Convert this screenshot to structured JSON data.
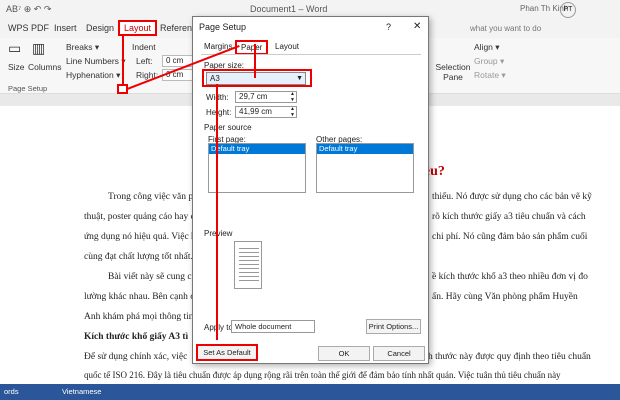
{
  "titlebar": {
    "quick": "AB⁷ ⊕ ↶ ↷",
    "title": "Document1 – Word",
    "user": "Phan Th Kinh",
    "initials": "PT"
  },
  "tabs": [
    "WPS PDF",
    "Insert",
    "Design",
    "Layout",
    "Reference"
  ],
  "tell_me": "what you want to do",
  "ribbon": {
    "size": "Size",
    "columns": "Columns",
    "breaks": "Breaks ▾",
    "line_numbers": "Line Numbers ▾",
    "hyphenation": "Hyphenation ▾",
    "indent": "Indent",
    "left": "Left:",
    "right": "Right:",
    "left_val": "0 cm",
    "right_val": "0 cm",
    "selection_pane": "Selection Pane",
    "align": "Align ▾",
    "group": "Group ▾",
    "rotate": "Rotate ▾",
    "page_setup": "Page Setup"
  },
  "doc": {
    "heading": "iêu?",
    "lines": [
      "Trong công việc văn phòng",
      "thiếu. Nó được sử dụng cho các bản vẽ kỹ",
      "thuật, poster quảng cáo hay các",
      "rõ kích thước giấy a3 tiêu chuẩn và cách",
      "ứng dụng nó hiệu quả. Việc hiểu",
      "chi phí. Nó cũng đảm bảo sản phẩm cuối",
      "cùng đạt chất lượng tốt nhất.",
      "Bài viết này sẽ cung cấp ch",
      "ề kích thước khổ a3 theo nhiều đơn vị đo",
      "lường khác nhau. Bên cạnh đó lầ",
      "ấn. Hãy cùng Văn phòng phẩm Huyền",
      "Anh khám phá mọi thông tin bar",
      "Kích thước khổ giấy A3 tì",
      "Để sử dụng chính xác, việc",
      "h thước này được quy định theo tiêu chuẩn",
      "quốc tế ISO 216. Đây là tiêu chuẩn được áp dụng rộng rãi trên toàn thế giới để đảm bảo tính nhất quán. Việc tuân thủ tiêu chuẩn này"
    ]
  },
  "status": {
    "words": "ords",
    "language": "Vietnamese"
  },
  "dialog": {
    "title": "Page Setup",
    "help": "?",
    "close": "✕",
    "tabs": [
      "Margins",
      "Paper",
      "Layout"
    ],
    "paper_size_label": "Paper size:",
    "paper_size": "A3",
    "width_label": "Width:",
    "width": "29,7 cm",
    "height_label": "Height:",
    "height": "41,99 cm",
    "paper_source": "Paper source",
    "first_page": "First page:",
    "other_pages": "Other pages:",
    "default_tray": "Default tray",
    "preview": "Preview",
    "apply_to": "Apply to:",
    "apply_value": "Whole document",
    "print_options": "Print Options...",
    "set_default": "Set As Default",
    "ok": "OK",
    "cancel": "Cancel"
  },
  "colors": {
    "annotation": "#e00000",
    "accent": "#2b579a",
    "heading": "#c00000"
  }
}
